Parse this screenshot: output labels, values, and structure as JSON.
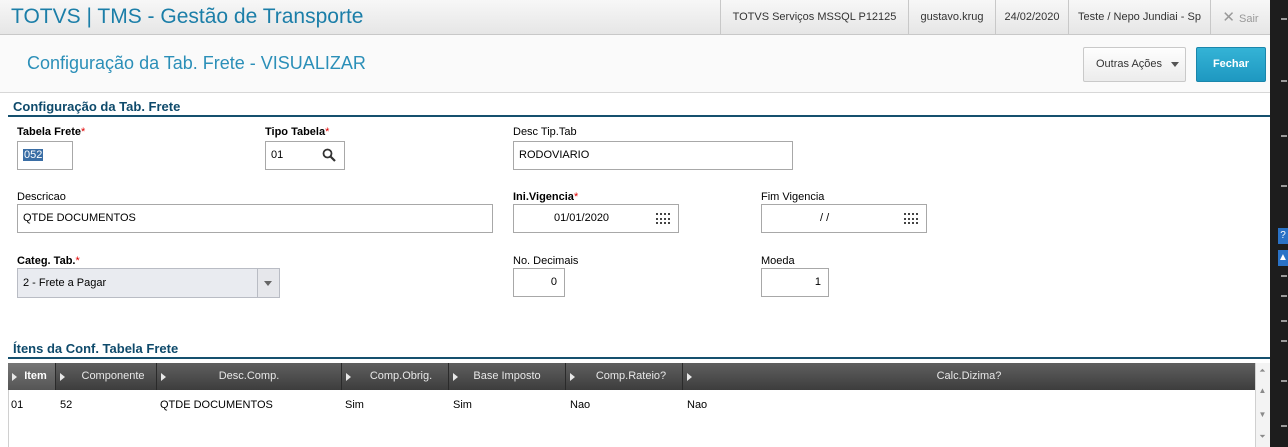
{
  "topbar": {
    "app_title": "TOTVS | TMS - Gestão de Transporte",
    "environment": "TOTVS Serviços MSSQL P12125",
    "user": "gustavo.krug",
    "date": "24/02/2020",
    "branch": "Teste / Nepo Jundiai - Sp",
    "sair_label": "Sair"
  },
  "page": {
    "title": "Configuração da Tab. Frete - VISUALIZAR",
    "outras_acoes_label": "Outras Ações",
    "fechar_label": "Fechar"
  },
  "section1": {
    "title": "Configuração da Tab. Frete",
    "required_mark": "*",
    "fields": {
      "tabela_frete": {
        "label": "Tabela Frete",
        "value": "052"
      },
      "tipo_tabela": {
        "label": "Tipo Tabela",
        "value": "01"
      },
      "desc_tip_tab": {
        "label": "Desc Tip.Tab",
        "value": "RODOVIARIO"
      },
      "descricao": {
        "label": "Descricao",
        "value": "QTDE DOCUMENTOS"
      },
      "ini_vigencia": {
        "label": "Ini.Vigencia",
        "value": "01/01/2020"
      },
      "fim_vigencia": {
        "label": "Fim Vigencia",
        "value": "/ /"
      },
      "categ_tab": {
        "label": "Categ. Tab.",
        "value": "2 - Frete a Pagar"
      },
      "no_decimais": {
        "label": "No. Decimais",
        "value": "0"
      },
      "moeda": {
        "label": "Moeda",
        "value": "1"
      }
    }
  },
  "section2": {
    "title": "Ítens da Conf. Tabela Frete",
    "columns": [
      "Item",
      "Componente",
      "Desc.Comp.",
      "Comp.Obrig.",
      "Base Imposto",
      "Comp.Rateio?",
      "Calc.Dizima?"
    ],
    "rows": [
      [
        "01",
        "52",
        "QTDE DOCUMENTOS",
        "Sim",
        "Sim",
        "Nao",
        "Nao"
      ]
    ]
  },
  "side_strip": {
    "button_label": "?"
  }
}
